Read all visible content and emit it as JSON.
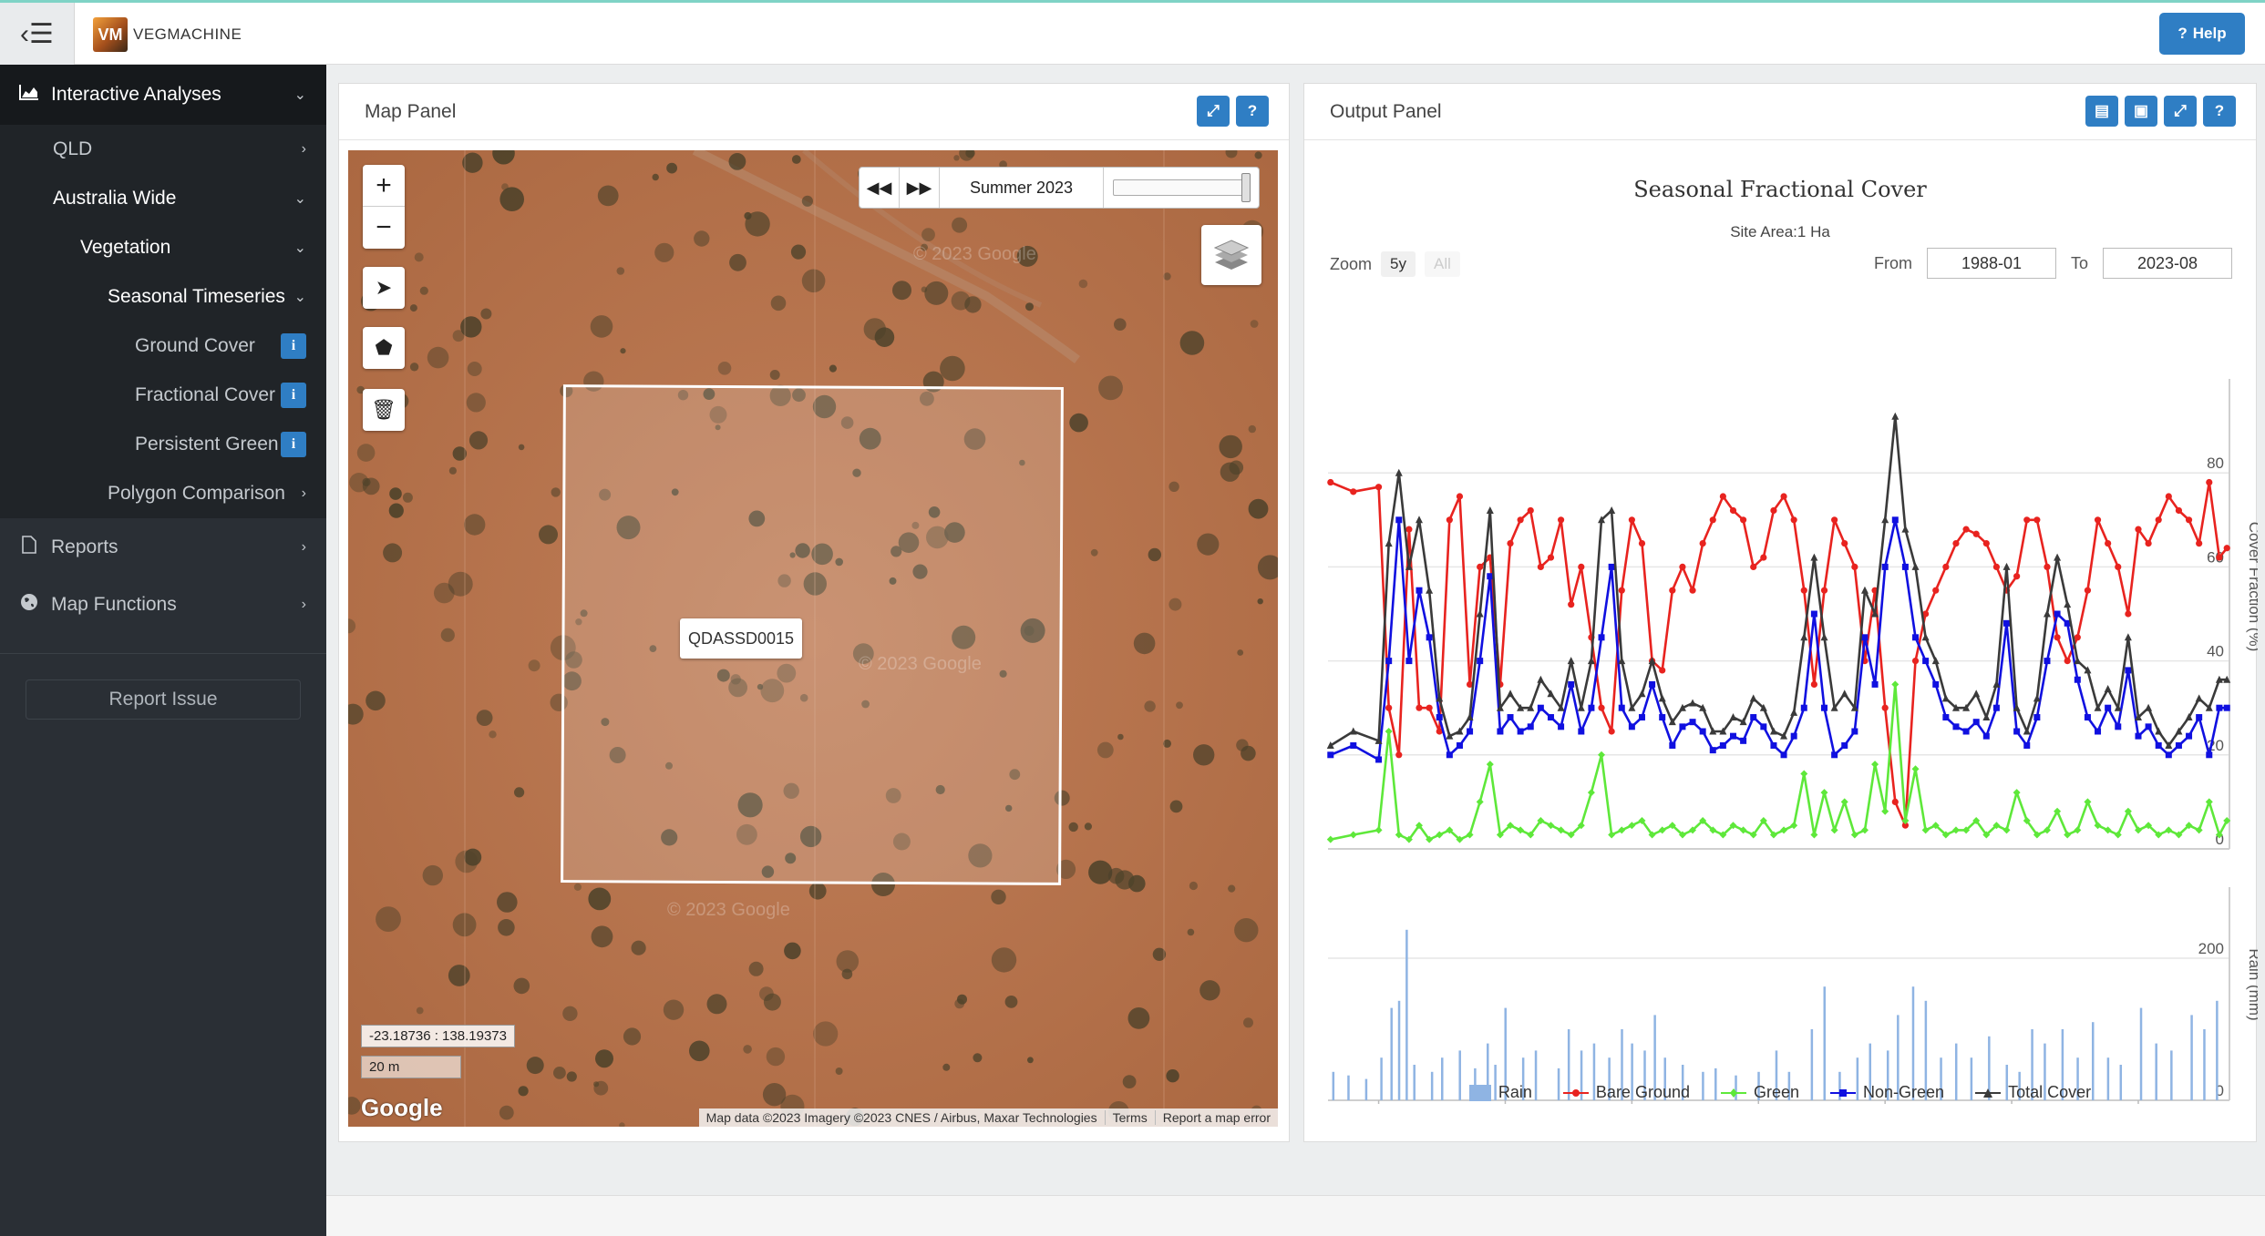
{
  "topbar": {
    "brand": "VEGMACHINE",
    "logo_text": "VM",
    "help_label": "Help",
    "menu_icon": "sidebar-toggle-icon"
  },
  "sidebar": {
    "interactive_analyses": "Interactive Analyses",
    "qld": "QLD",
    "australia_wide": "Australia Wide",
    "vegetation": "Vegetation",
    "seasonal_timeseries": "Seasonal Timeseries",
    "ground_cover": "Ground Cover",
    "fractional_cover": "Fractional Cover",
    "persistent_green": "Persistent Green",
    "polygon_comparison": "Polygon Comparison",
    "reports": "Reports",
    "map_functions": "Map Functions",
    "report_issue": "Report Issue",
    "info_glyph": "i"
  },
  "map_panel": {
    "title": "Map Panel",
    "time_label": "Summer 2023",
    "polygon_label": "QDASSD0015",
    "coordinates": "-23.18736 : 138.19373",
    "scale": "20 m",
    "google": "Google",
    "attribution": "Map data ©2023 Imagery ©2023 CNES / Airbus, Maxar Technologies",
    "terms": "Terms",
    "report_error": "Report a map error",
    "watermark": "© 2023 Google"
  },
  "output_panel": {
    "title": "Output Panel",
    "zoom_label": "Zoom",
    "zoom_options": [
      "5y",
      "All"
    ],
    "from_label": "From",
    "from_value": "1988-01",
    "to_label": "To",
    "to_value": "2023-08"
  },
  "colors": {
    "accent": "#2f7ec4",
    "bare": "#e8231f",
    "green": "#5ee83a",
    "nongreen": "#1010e0",
    "total": "#3a3a3a",
    "rain": "#8fb4e3"
  },
  "chart_data": {
    "type": "line",
    "title": "Seasonal Fractional Cover",
    "subtitle": "Site Area:1 Ha",
    "ylabel": "Cover Fraction (%)",
    "ylim": [
      0,
      100
    ],
    "yticks": [
      "0",
      "20",
      "40",
      "60",
      "80"
    ],
    "xlabel": "",
    "xlim": [
      1988.0,
      2023.6
    ],
    "xticks": [
      "1990",
      "1995",
      "2000",
      "2005",
      "2010",
      "2015",
      "2020"
    ],
    "grid": true,
    "legend": "bottom",
    "x": [
      1988.1,
      1989.0,
      1990.0,
      1990.4,
      1990.8,
      1991.2,
      1991.6,
      1992.0,
      1992.4,
      1992.8,
      1993.2,
      1993.6,
      1994.0,
      1994.4,
      1994.8,
      1995.2,
      1995.6,
      1996.0,
      1996.4,
      1996.8,
      1997.2,
      1997.6,
      1998.0,
      1998.4,
      1998.8,
      1999.2,
      1999.6,
      2000.0,
      2000.4,
      2000.8,
      2001.2,
      2001.6,
      2002.0,
      2002.4,
      2002.8,
      2003.2,
      2003.6,
      2004.0,
      2004.4,
      2004.8,
      2005.2,
      2005.6,
      2006.0,
      2006.4,
      2006.8,
      2007.2,
      2007.6,
      2008.0,
      2008.4,
      2008.8,
      2009.2,
      2009.6,
      2010.0,
      2010.4,
      2010.8,
      2011.2,
      2011.6,
      2012.0,
      2012.4,
      2012.8,
      2013.2,
      2013.6,
      2014.0,
      2014.4,
      2014.8,
      2015.2,
      2015.6,
      2016.0,
      2016.4,
      2016.8,
      2017.2,
      2017.6,
      2018.0,
      2018.4,
      2018.8,
      2019.2,
      2019.6,
      2020.0,
      2020.4,
      2020.8,
      2021.2,
      2021.6,
      2022.0,
      2022.4,
      2022.8,
      2023.2,
      2023.5
    ],
    "series": [
      {
        "name": "Bare Ground",
        "color": "#e8231f",
        "values": [
          78,
          76,
          77,
          30,
          20,
          68,
          30,
          30,
          25,
          70,
          75,
          35,
          60,
          62,
          35,
          65,
          70,
          72,
          60,
          62,
          70,
          52,
          60,
          45,
          30,
          25,
          55,
          70,
          65,
          40,
          38,
          55,
          60,
          55,
          65,
          70,
          75,
          72,
          70,
          60,
          62,
          72,
          75,
          70,
          55,
          35,
          55,
          70,
          65,
          60,
          40,
          55,
          30,
          10,
          5,
          40,
          50,
          55,
          60,
          65,
          68,
          67,
          65,
          60,
          55,
          58,
          70,
          70,
          60,
          45,
          40,
          45,
          55,
          70,
          65,
          60,
          50,
          68,
          65,
          70,
          75,
          72,
          70,
          65,
          78,
          62,
          64
        ]
      },
      {
        "name": "Green",
        "color": "#5ee83a",
        "values": [
          2,
          3,
          4,
          25,
          3,
          2,
          5,
          2,
          3,
          4,
          2,
          3,
          10,
          18,
          3,
          5,
          4,
          3,
          6,
          5,
          4,
          3,
          5,
          12,
          20,
          3,
          4,
          5,
          6,
          3,
          4,
          5,
          3,
          4,
          6,
          4,
          3,
          5,
          4,
          3,
          6,
          3,
          4,
          5,
          16,
          3,
          12,
          4,
          10,
          3,
          4,
          18,
          8,
          35,
          6,
          17,
          4,
          5,
          3,
          4,
          4,
          6,
          3,
          5,
          4,
          12,
          6,
          3,
          4,
          8,
          3,
          4,
          10,
          5,
          4,
          3,
          8,
          4,
          5,
          3,
          4,
          3,
          5,
          4,
          10,
          3,
          6
        ]
      },
      {
        "name": "Non-Green",
        "color": "#1010e0",
        "values": [
          20,
          22,
          19,
          40,
          70,
          40,
          55,
          45,
          28,
          20,
          22,
          25,
          40,
          58,
          25,
          28,
          25,
          26,
          30,
          28,
          26,
          35,
          25,
          30,
          45,
          60,
          30,
          26,
          28,
          35,
          28,
          22,
          26,
          27,
          25,
          21,
          22,
          24,
          23,
          28,
          26,
          22,
          20,
          24,
          30,
          50,
          30,
          20,
          22,
          25,
          45,
          35,
          60,
          70,
          60,
          45,
          40,
          35,
          28,
          26,
          25,
          27,
          24,
          30,
          48,
          25,
          22,
          28,
          40,
          50,
          48,
          36,
          28,
          25,
          30,
          26,
          38,
          24,
          26,
          22,
          20,
          22,
          24,
          28,
          20,
          30,
          30
        ]
      },
      {
        "name": "Total Cover",
        "color": "#3a3a3a",
        "values": [
          22,
          25,
          23,
          65,
          80,
          60,
          70,
          55,
          32,
          24,
          25,
          28,
          50,
          72,
          30,
          33,
          30,
          30,
          36,
          33,
          30,
          40,
          30,
          40,
          70,
          72,
          40,
          30,
          33,
          40,
          32,
          27,
          30,
          31,
          30,
          25,
          25,
          28,
          27,
          32,
          30,
          25,
          24,
          29,
          45,
          62,
          45,
          30,
          33,
          30,
          55,
          50,
          70,
          92,
          68,
          60,
          45,
          40,
          32,
          30,
          30,
          33,
          28,
          35,
          60,
          30,
          25,
          32,
          50,
          62,
          52,
          40,
          38,
          30,
          34,
          30,
          45,
          28,
          30,
          25,
          22,
          25,
          28,
          32,
          30,
          36,
          36
        ]
      }
    ],
    "rain": {
      "name": "Rain",
      "ylabel": "Rain (mm)",
      "yticks": [
        "0",
        "200"
      ],
      "ylim": [
        0,
        300
      ],
      "x": [
        1988.2,
        1988.8,
        1989.5,
        1990.1,
        1990.5,
        1990.8,
        1991.1,
        1991.4,
        1992.1,
        1992.5,
        1993.2,
        1993.8,
        1994.3,
        1994.6,
        1995.0,
        1995.7,
        1996.2,
        1997.1,
        1997.5,
        1998.0,
        1998.5,
        1999.1,
        1999.6,
        2000.0,
        2000.5,
        2000.9,
        2001.3,
        2002.0,
        2002.8,
        2003.3,
        2004.1,
        2005.0,
        2005.7,
        2006.2,
        2007.1,
        2007.6,
        2008.2,
        2008.9,
        2009.4,
        2010.1,
        2010.5,
        2011.1,
        2011.6,
        2012.2,
        2012.8,
        2013.4,
        2014.1,
        2014.8,
        2015.3,
        2015.8,
        2016.3,
        2017.0,
        2017.6,
        2018.2,
        2018.8,
        2019.3,
        2020.1,
        2020.7,
        2021.3,
        2022.1,
        2022.6,
        2023.1
      ],
      "values": [
        40,
        35,
        30,
        60,
        130,
        140,
        240,
        50,
        40,
        60,
        70,
        45,
        80,
        50,
        130,
        60,
        70,
        45,
        100,
        70,
        80,
        60,
        100,
        80,
        70,
        120,
        60,
        50,
        40,
        45,
        35,
        40,
        70,
        40,
        100,
        160,
        40,
        60,
        80,
        70,
        120,
        160,
        140,
        60,
        80,
        60,
        90,
        50,
        40,
        100,
        80,
        100,
        60,
        110,
        60,
        50,
        130,
        80,
        70,
        120,
        100,
        140
      ]
    }
  }
}
